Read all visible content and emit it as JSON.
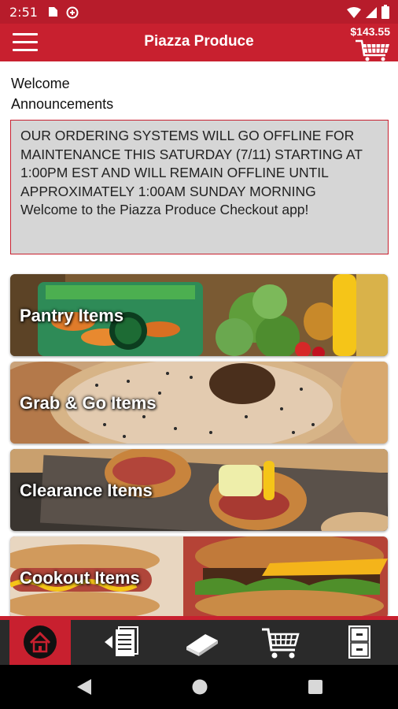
{
  "status_bar": {
    "time": "2:51"
  },
  "app_bar": {
    "title": "Piazza Produce",
    "cart_total": "$143.55"
  },
  "main": {
    "welcome": "Welcome",
    "announcements_heading": "Announcements",
    "announcement_text": "OUR ORDERING SYSTEMS WILL GO OFFLINE FOR MAINTENANCE THIS SATURDAY (7/11) STARTING AT 1:00PM EST AND WILL REMAIN OFFLINE UNTIL APPROXIMATELY 1:00AM SUNDAY MORNING",
    "welcome_message": "Welcome to the Piazza Produce Checkout app!",
    "categories": [
      {
        "label": "Pantry Items"
      },
      {
        "label": "Grab & Go Items"
      },
      {
        "label": "Clearance Items"
      },
      {
        "label": "Cookout Items"
      }
    ]
  },
  "bottom_nav": {
    "items": [
      "home-icon",
      "order-list-icon",
      "catalog-book-icon",
      "cart-icon",
      "cabinet-icon"
    ],
    "active": "home-icon"
  },
  "colors": {
    "brand_red": "#c8202f",
    "status_red": "#b71c2b",
    "nav_dark": "#2a2a2a"
  }
}
